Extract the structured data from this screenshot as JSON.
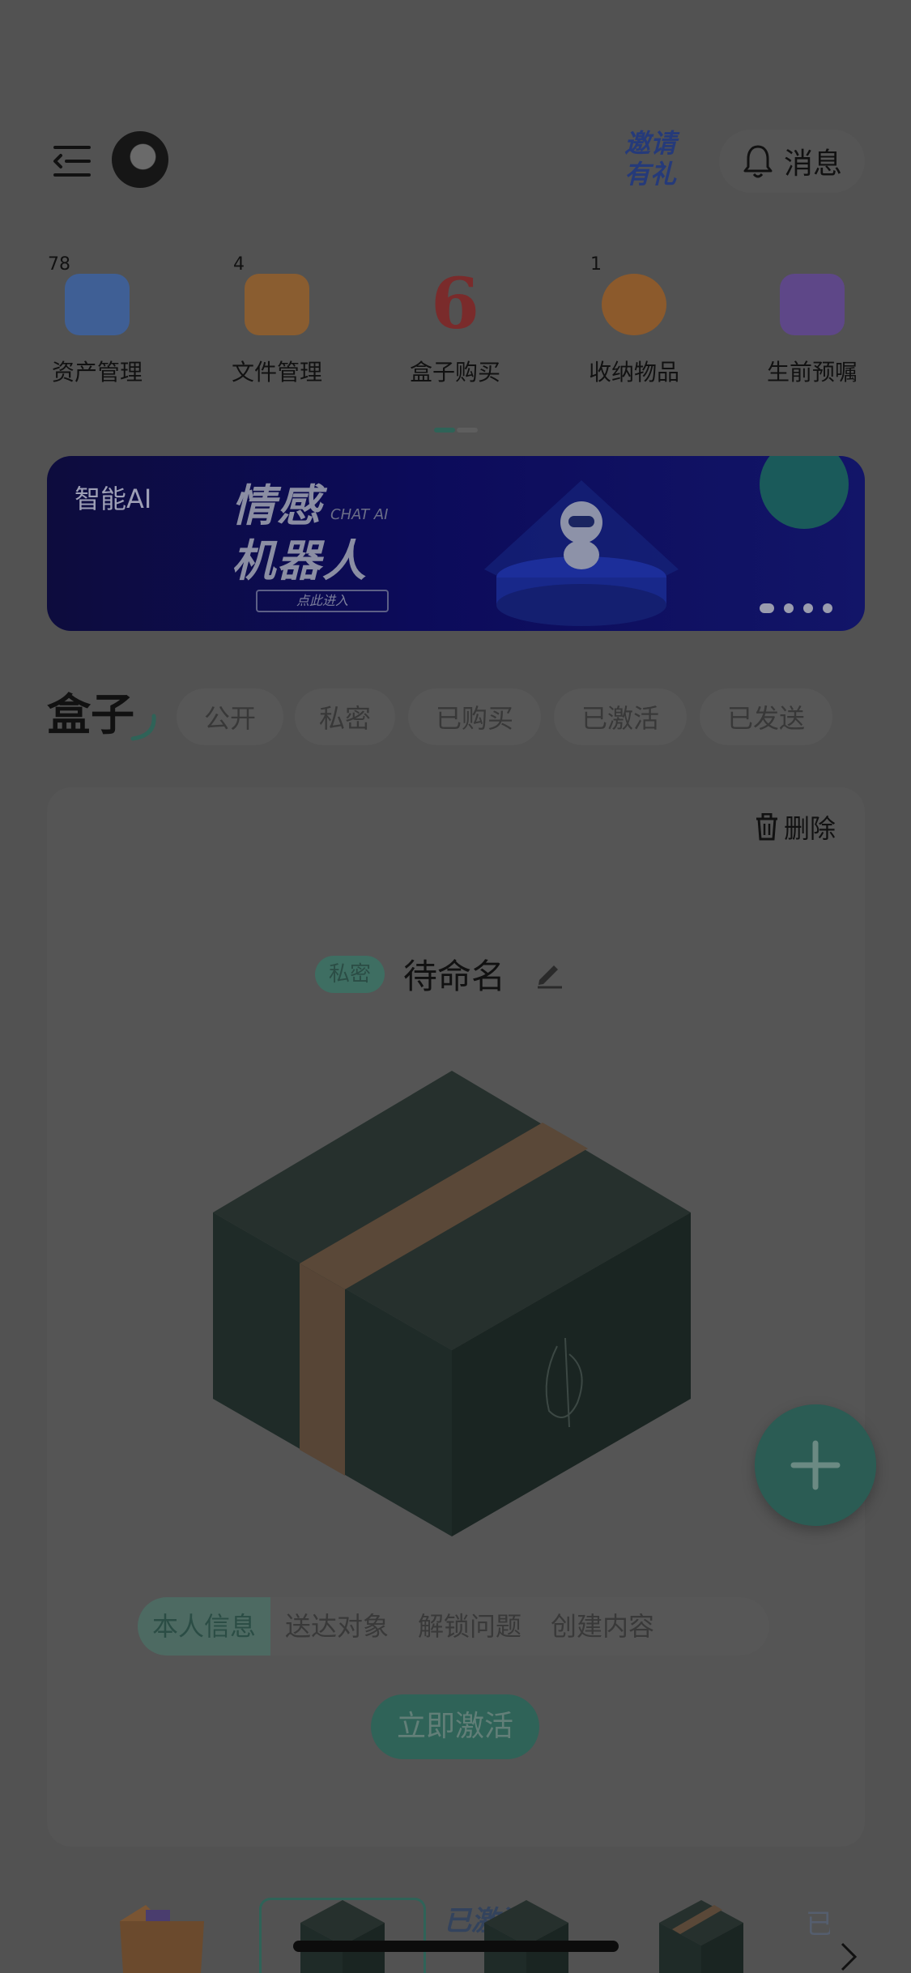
{
  "header": {
    "menu_icon": "menu-collapse-icon",
    "invite_line1": "邀请",
    "invite_line2": "有礼",
    "message_label": "消息",
    "message_icon": "bell-icon"
  },
  "quick_nav": [
    {
      "label": "资产管理",
      "count": "78",
      "icon": "wallet-icon",
      "color": "#3f5f95"
    },
    {
      "label": "文件管理",
      "count": "4",
      "icon": "folder-add-icon",
      "color": "#8a5d30"
    },
    {
      "label": "盒子购买",
      "count": "",
      "icon": "anniversary-6-icon",
      "color": "#7a2b2b"
    },
    {
      "label": "收纳物品",
      "count": "1",
      "icon": "storage-icon",
      "color": "#8c5a2c"
    },
    {
      "label": "生前预嘱",
      "count": "",
      "icon": "document-icon",
      "color": "#5e4788"
    }
  ],
  "banner": {
    "label": "智能AI",
    "title_line1": "情感",
    "title_line2": "机器人",
    "subtitle": "CHAT AI",
    "enter_text": "点此进入"
  },
  "boxes": {
    "title": "盒子",
    "filters": [
      "公开",
      "私密",
      "已购买",
      "已激活",
      "已发送"
    ]
  },
  "card": {
    "delete_label": "删除",
    "tag": "私密",
    "name": "待命名",
    "info_tabs": [
      "本人信息",
      "送达对象",
      "解锁问题",
      "创建内容"
    ],
    "active_tab_index": 0,
    "activate_label": "立即激活"
  },
  "bottom_strip": {
    "status_label": "已激活",
    "status_label_2": "已"
  },
  "colors": {
    "overlay_background": "#525252",
    "accent": "#2f6358",
    "banner": "#0c0b5a"
  }
}
